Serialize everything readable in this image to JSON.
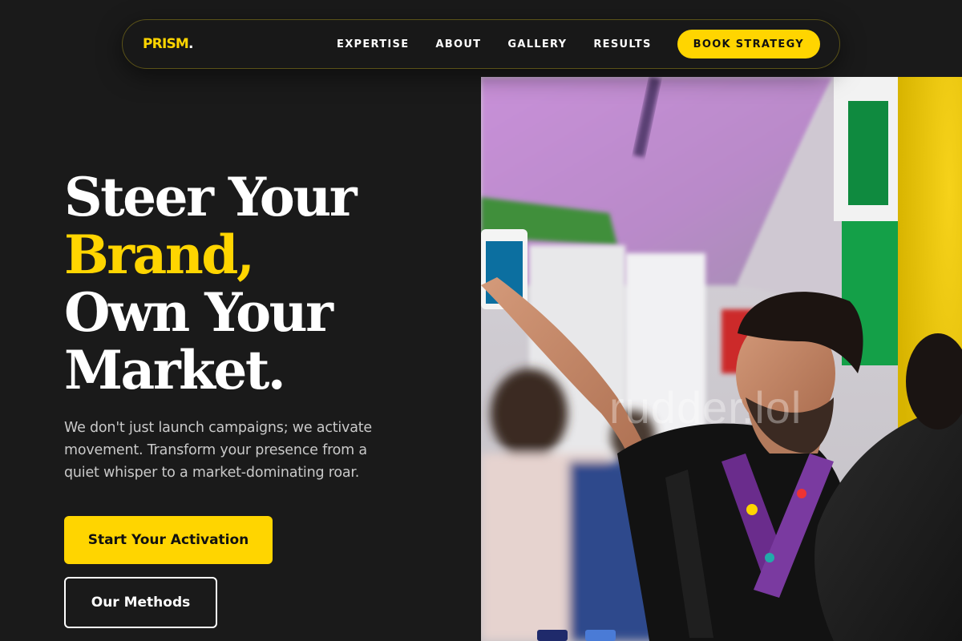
{
  "brand": {
    "name": "PRISM",
    "dot": "."
  },
  "nav": {
    "links": [
      "EXPERTISE",
      "ABOUT",
      "GALLERY",
      "RESULTS"
    ],
    "cta_label": "BOOK STRATEGY"
  },
  "hero": {
    "headline_line1": "Steer Your",
    "headline_line2": "Brand,",
    "headline_line3": "Own Your",
    "headline_line4": "Market.",
    "subtext": "We don't just launch campaigns; we activate movement. Transform your presence from a quiet whisper to a market-dominating roar.",
    "primary_button": "Start Your Activation",
    "secondary_button": "Our Methods"
  },
  "image": {
    "watermark": "rudder.lol"
  },
  "colors": {
    "accent": "#ffd500",
    "background": "#1a1a1a",
    "text": "#ffffff",
    "muted": "#c9c9c9"
  }
}
